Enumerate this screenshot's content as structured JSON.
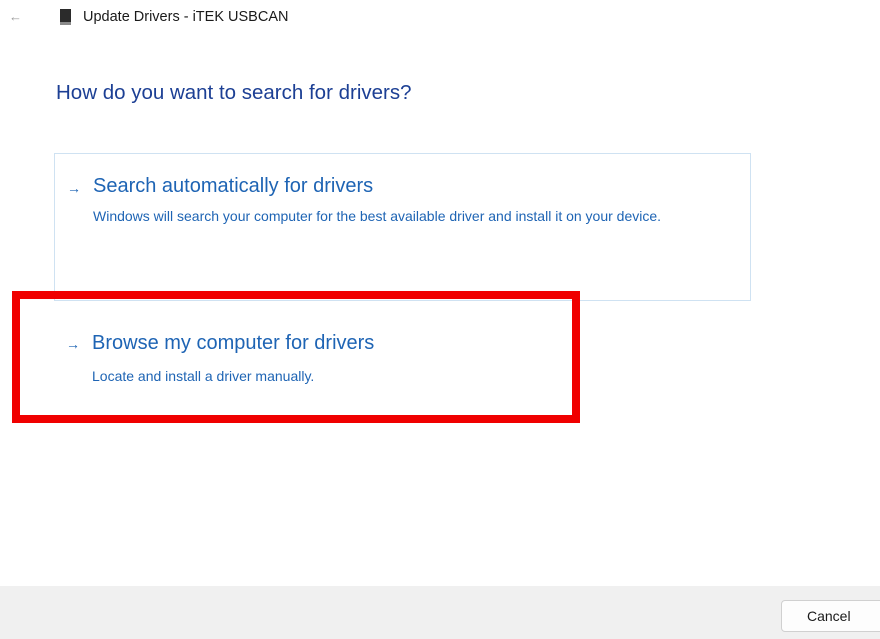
{
  "window": {
    "back_icon": "back-arrow-icon",
    "device_icon": "usb-device-icon",
    "title": "Update Drivers - iTEK USBCAN"
  },
  "heading": "How do you want to search for drivers?",
  "options": [
    {
      "arrow": "→",
      "title": "Search automatically for drivers",
      "description": "Windows will search your computer for the best available driver and install it on your device."
    },
    {
      "arrow": "→",
      "title": "Browse my computer for drivers",
      "description": "Locate and install a driver manually."
    }
  ],
  "footer": {
    "cancel_label": "Cancel"
  },
  "colors": {
    "heading": "#1c3f94",
    "link": "#1e64b4",
    "highlight": "#f00000",
    "option_border": "#cfe2f2",
    "footer_bg": "#f0f0f0"
  }
}
